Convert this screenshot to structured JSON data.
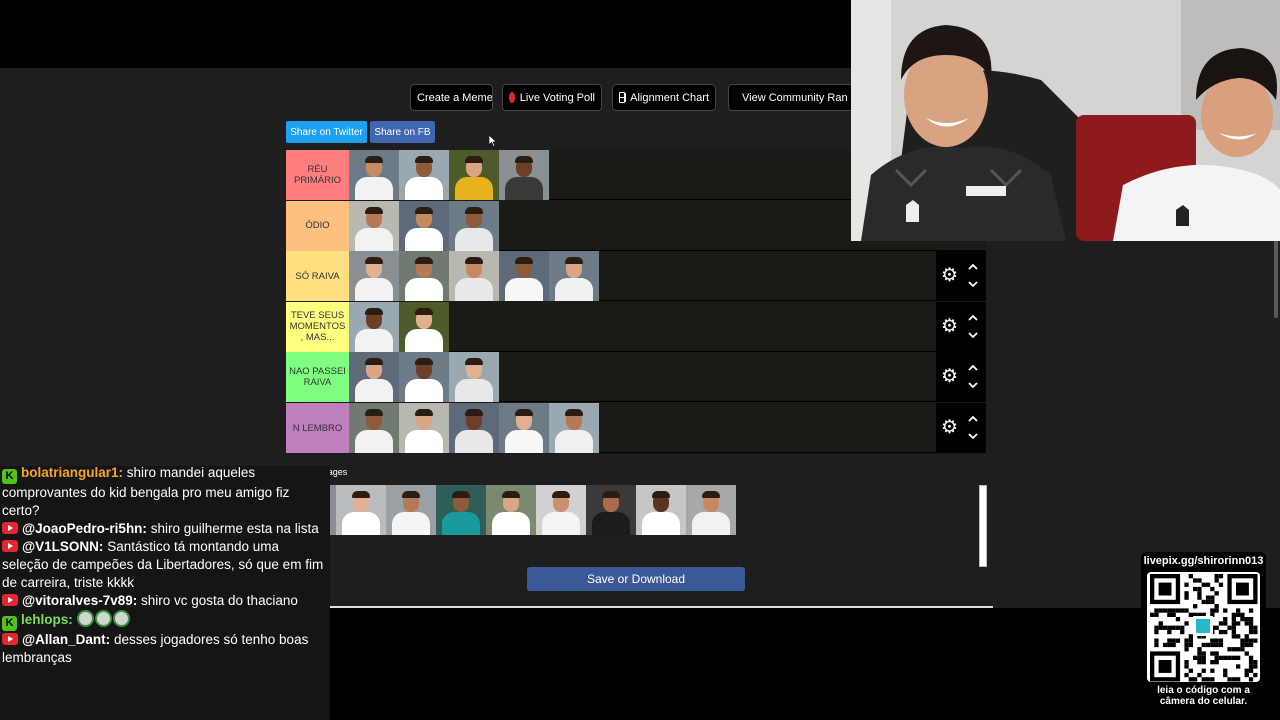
{
  "toolbar": {
    "create_meme": "Create a Meme",
    "live_voting": "Live Voting Poll",
    "alignment_chart": "Alignment Chart",
    "community_rank": "View Community Ran"
  },
  "share": {
    "twitter": "Share on Twitter",
    "facebook": "Share on FB"
  },
  "tiers": [
    {
      "label": "RÉU PRIMÁRIO",
      "color": "#ff7f7f",
      "count": 4,
      "controls": false
    },
    {
      "label": "ÓDIO",
      "color": "#ffbf7f",
      "count": 3,
      "controls": false
    },
    {
      "label": "SÓ RAIVA",
      "color": "#ffdf7f",
      "count": 5,
      "controls": true
    },
    {
      "label": "TEVE SEUS MOMENTOS , MAS...",
      "color": "#ffff7f",
      "count": 2,
      "controls": true
    },
    {
      "label": "NAO PASSEI RAIVA",
      "color": "#7fff7f",
      "count": 3,
      "controls": true
    },
    {
      "label": "N LEMBRO",
      "color": "#bf7fbf",
      "count": 5,
      "controls": true
    }
  ],
  "pin_images": "Pin Images",
  "pool_count": 9,
  "save_button": "Save or Download",
  "chat": [
    {
      "platform": "kick",
      "user": "bolatriangular1:",
      "user_color": "orange",
      "text": "shiro mandei aqueles comprovantes do kid bengala pro meu amigo fiz certo?"
    },
    {
      "platform": "youtube",
      "user": "@JoaoPedro-ri5hn:",
      "user_color": "white",
      "text": "shiro guilherme esta na lista"
    },
    {
      "platform": "youtube",
      "user": "@V1LSONN:",
      "user_color": "white",
      "text": "Santástico tá montando uma seleção de campeões da Libertadores, só que em fim de carreira, triste kkkk"
    },
    {
      "platform": "youtube",
      "user": "@vitoralves-7v89:",
      "user_color": "white",
      "text": "shiro vc gosta do thaciano"
    },
    {
      "platform": "kick",
      "user": "lehlops:",
      "user_color": "green",
      "text": "",
      "emotes": 3
    },
    {
      "platform": "youtube",
      "user": "@Allan_Dant:",
      "user_color": "white",
      "text": "desses jogadores só tenho boas lembranças"
    }
  ],
  "qr": {
    "url": "livepix.gg/shirorinn013",
    "caption_line1": "leia o código com a",
    "caption_line2": "câmera do celular."
  }
}
